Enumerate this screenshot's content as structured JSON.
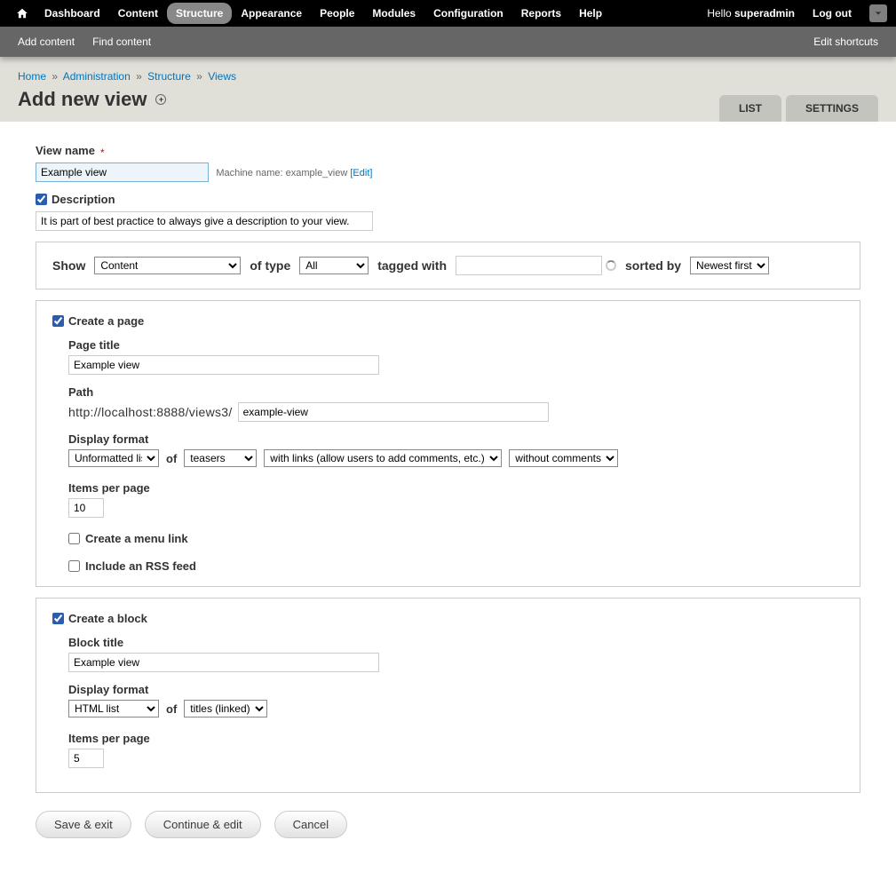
{
  "toolbar": {
    "items": [
      "Dashboard",
      "Content",
      "Structure",
      "Appearance",
      "People",
      "Modules",
      "Configuration",
      "Reports",
      "Help"
    ],
    "hello": "Hello ",
    "user": "superadmin",
    "logout": "Log out"
  },
  "shortcuts": {
    "add": "Add content",
    "find": "Find content",
    "edit": "Edit shortcuts"
  },
  "breadcrumb": {
    "home": "Home",
    "admin": "Administration",
    "structure": "Structure",
    "views": "Views"
  },
  "title": "Add new view",
  "tabs": {
    "list": "LIST",
    "settings": "SETTINGS"
  },
  "form": {
    "view_name_label": "View name",
    "view_name_value": "Example view",
    "machine_name_label": "Machine name: ",
    "machine_name_value": "example_view",
    "machine_name_edit": "[Edit]",
    "description_label": "Description",
    "description_value": "It is part of best practice to always give a description to your view.",
    "show_label": "Show",
    "show_value": "Content",
    "of_type_label": "of type",
    "of_type_value": "All",
    "tagged_label": "tagged with",
    "tagged_value": "",
    "sorted_label": "sorted by",
    "sorted_value": "Newest first"
  },
  "page": {
    "create_label": "Create a page",
    "title_label": "Page title",
    "title_value": "Example view",
    "path_label": "Path",
    "path_base": "http://localhost:8888/views3/",
    "path_value": "example-view",
    "display_format_label": "Display format",
    "format_value": "Unformatted list",
    "of": "of",
    "of_value": "teasers",
    "links_value": "with links (allow users to add comments, etc.)",
    "comments_value": "without comments",
    "items_label": "Items per page",
    "items_value": "10",
    "menu_link": "Create a menu link",
    "rss": "Include an RSS feed"
  },
  "block": {
    "create_label": "Create a block",
    "title_label": "Block title",
    "title_value": "Example view",
    "display_format_label": "Display format",
    "format_value": "HTML list",
    "of": "of",
    "of_value": "titles (linked)",
    "items_label": "Items per page",
    "items_value": "5"
  },
  "buttons": {
    "save_exit": "Save & exit",
    "continue_edit": "Continue & edit",
    "cancel": "Cancel"
  }
}
